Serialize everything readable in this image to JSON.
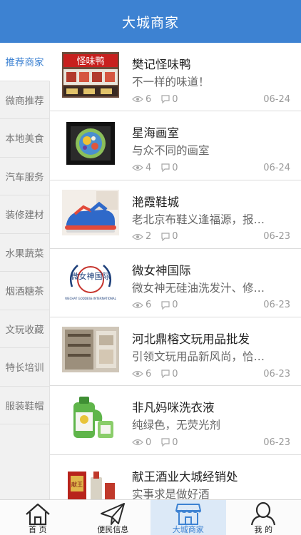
{
  "header": {
    "title": "大城商家"
  },
  "sidebar": {
    "items": [
      {
        "label": "推荐商家"
      },
      {
        "label": "微商推荐"
      },
      {
        "label": "本地美食"
      },
      {
        "label": "汽车服务"
      },
      {
        "label": "装修建材"
      },
      {
        "label": "水果蔬菜"
      },
      {
        "label": "烟酒糖茶"
      },
      {
        "label": "文玩收藏"
      },
      {
        "label": "特长培训"
      },
      {
        "label": "服装鞋帽"
      }
    ]
  },
  "list": {
    "items": [
      {
        "name": "樊记怪味鸭",
        "desc": "不一样的味道！",
        "views": "6",
        "comments": "0",
        "date": "06-24",
        "thumb_text": "怪味鸭"
      },
      {
        "name": "星海画室",
        "desc": "与众不同的画室",
        "views": "4",
        "comments": "0",
        "date": "06-24"
      },
      {
        "name": "滟霞鞋城",
        "desc": "老北京布鞋义逢福源，报…",
        "views": "2",
        "comments": "0",
        "date": "06-23"
      },
      {
        "name": "微女神国际",
        "desc": "微女神无硅油洗发汁、修…",
        "views": "6",
        "comments": "0",
        "date": "06-23",
        "thumb_text": "微女神国际",
        "thumb_subtext": "WECHAT GODDESS INTERNATIONAL"
      },
      {
        "name": "河北鼎榕文玩用品批发",
        "desc": "引领文玩用品新风尚，恰…",
        "views": "6",
        "comments": "0",
        "date": "06-23"
      },
      {
        "name": "非凡妈咪洗衣液",
        "desc": "纯绿色，无荧光剂",
        "views": "0",
        "comments": "0",
        "date": "06-23"
      },
      {
        "name": "献王酒业大城经销处",
        "desc": "实事求是做好酒",
        "views": "",
        "comments": "",
        "date": "",
        "thumb_text": "献王"
      }
    ]
  },
  "tabbar": {
    "tabs": [
      {
        "label": "首 页",
        "icon": "home-icon"
      },
      {
        "label": "便民信息",
        "icon": "paper-plane-icon"
      },
      {
        "label": "大城商家",
        "icon": "store-icon"
      },
      {
        "label": "我 的",
        "icon": "user-icon"
      }
    ]
  },
  "colors": {
    "accent": "#3d82d2",
    "header_bg": "#3d82d2",
    "sidebar_bg": "#f1f1f1",
    "active_tab_bg": "#dce9f7"
  }
}
